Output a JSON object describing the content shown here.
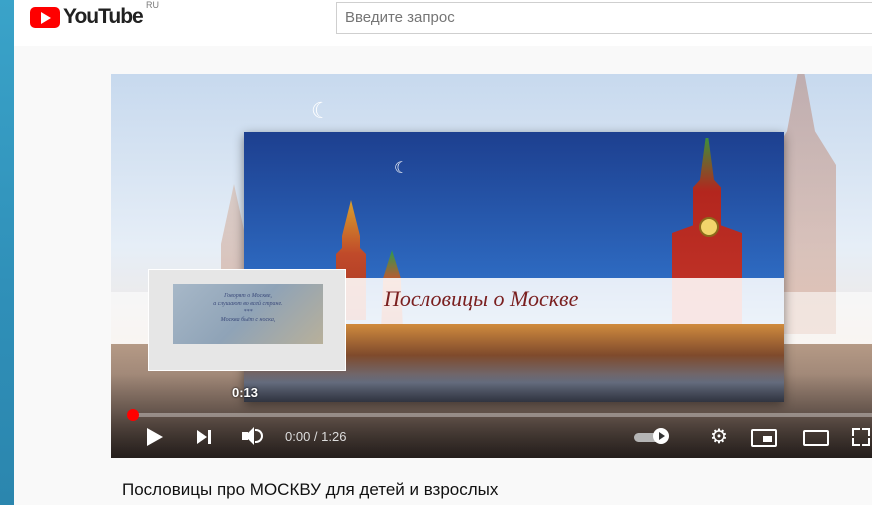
{
  "header": {
    "logo_text": "YouTube",
    "region": "RU",
    "search_placeholder": "Введите запрос"
  },
  "player": {
    "card_title": "Пословицы о Москве",
    "preview": {
      "lines": [
        "Говорят о Москве,",
        "а слушают во всей стране.",
        "***",
        "Москва бьёт с носка,"
      ],
      "time": "0:13"
    },
    "progress_fraction": 0.0,
    "time_display": "0:00 / 1:26",
    "accent_color": "#ff0000",
    "controls": {
      "play": "play-icon",
      "next": "next-icon",
      "volume": "volume-icon",
      "autoplay": "autoplay-toggle",
      "settings": "gear-icon",
      "miniplayer": "miniplayer-icon",
      "theater": "theater-icon",
      "fullscreen": "fullscreen-icon"
    }
  },
  "video": {
    "title": "Пословицы про МОСКВУ для детей и взрослых"
  }
}
